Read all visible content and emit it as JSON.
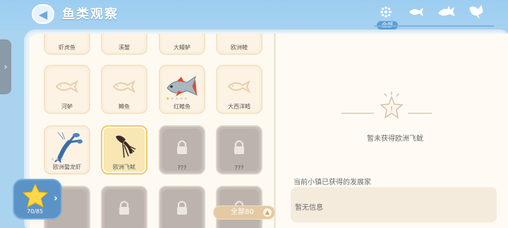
{
  "header": {
    "title": "鱼类观察",
    "back_icon": "chevron-left-icon"
  },
  "filter_tabs": {
    "all_label": "全部",
    "tabs": [
      {
        "icon": "grid-all-icon"
      },
      {
        "icon": "small-fish-icon"
      },
      {
        "icon": "medium-fish-icon"
      },
      {
        "icon": "large-fish-icon"
      }
    ]
  },
  "side_tab": {
    "icon": "chevron-right-icon"
  },
  "fish_cards": {
    "row0": [
      {
        "name": "虾虎鱼"
      },
      {
        "name": "溪蟹"
      },
      {
        "name": "大鳗鲈"
      },
      {
        "name": "欧洲鳇"
      }
    ],
    "row1": [
      {
        "name": "河鲈",
        "state": "unobtained"
      },
      {
        "name": "鳟鱼",
        "state": "unobtained"
      },
      {
        "name": "红鳍鱼",
        "state": "obtained",
        "stars": 1
      },
      {
        "name": "大西洋鳕",
        "state": "unobtained"
      }
    ],
    "row2": [
      {
        "name": "欧洲螯龙虾",
        "state": "obtained",
        "stars": 0
      },
      {
        "name": "欧洲飞鱿",
        "state": "selected",
        "stars": 0
      },
      {
        "name": "???",
        "state": "locked"
      },
      {
        "name": "???",
        "state": "locked"
      }
    ]
  },
  "detail": {
    "not_obtained_text": "暂未获得欧洲飞鱿",
    "developers_title": "当前小镇已获得的发展家",
    "developers_empty": "暂无信息"
  },
  "progress": {
    "text": "70/85",
    "fraction": 0.8235
  },
  "count_filter": {
    "label": "全部80"
  },
  "colors": {
    "accent_blue": "#5a9fd6",
    "card_bg": "#fbf0df",
    "locked_bg": "#c6bdb6",
    "selected_bg": "#fbe5a2",
    "star_on": "#f5b800"
  }
}
